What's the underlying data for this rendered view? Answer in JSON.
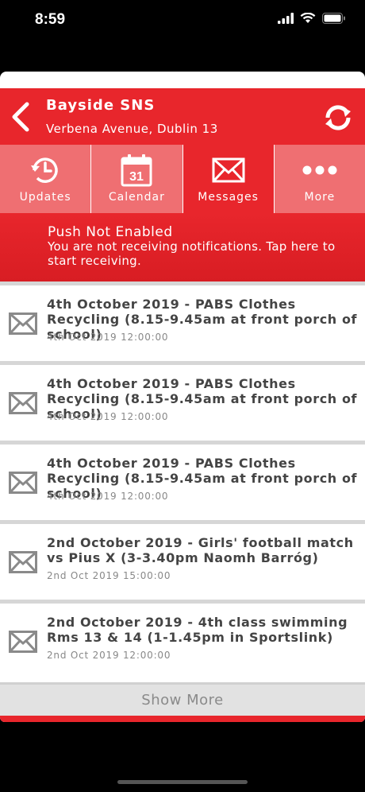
{
  "status_bar": {
    "time": "8:59"
  },
  "header": {
    "school_name": "Bayside SNS",
    "address": "Verbena Avenue, Dublin 13"
  },
  "tabs": [
    {
      "label": "Updates",
      "icon": "clock-refresh-icon",
      "active": false
    },
    {
      "label": "Calendar",
      "icon": "calendar-icon",
      "calendar_day": "31",
      "active": false
    },
    {
      "label": "Messages",
      "icon": "envelope-icon",
      "active": true
    },
    {
      "label": "More",
      "icon": "more-dots-icon",
      "active": false
    }
  ],
  "push_banner": {
    "title": "Push Not Enabled",
    "text": "You are not receiving notifications. Tap here to start receiving."
  },
  "messages": [
    {
      "title": "4th October 2019 - PABS Clothes Recycling (8.15-9.45am at front porch of school)",
      "date": "4th Oct 2019 12:00:00"
    },
    {
      "title": "4th October 2019 - PABS Clothes Recycling (8.15-9.45am at front porch of school)",
      "date": "4th Oct 2019 12:00:00"
    },
    {
      "title": "4th October 2019 - PABS Clothes Recycling (8.15-9.45am at front porch of school)",
      "date": "4th Oct 2019 12:00:00"
    },
    {
      "title": "2nd October 2019 - Girls' football match vs Pius X (3-3.40pm Naomh Barróg)",
      "date": "2nd Oct 2019 15:00:00"
    },
    {
      "title": "2nd October 2019 - 4th class swimming Rms 13 & 14 (1-1.45pm in Sportslink)",
      "date": "2nd Oct 2019 12:00:00"
    }
  ],
  "show_more_label": "Show More",
  "colors": {
    "brand_red": "#e8262c",
    "tab_inactive": "#ef6f72",
    "text_dark": "#444444",
    "text_muted": "#888888"
  }
}
